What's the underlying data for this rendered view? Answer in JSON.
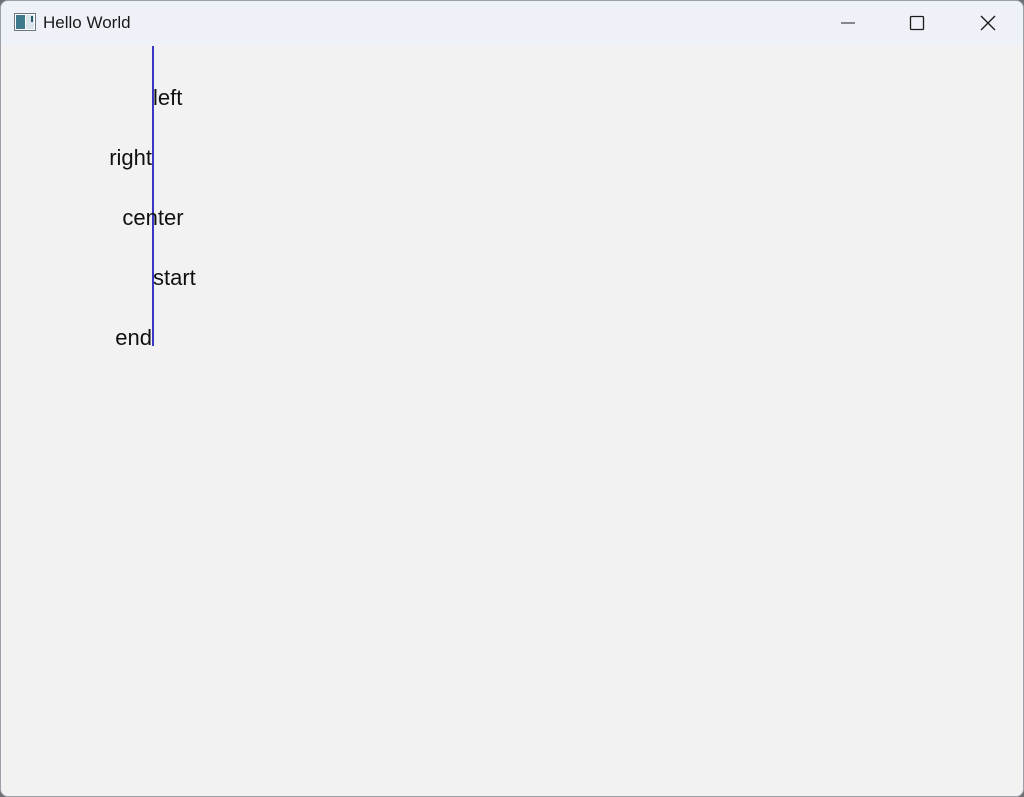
{
  "window": {
    "title": "Hello World",
    "icon": "app-window-icon",
    "controls": {
      "minimize_icon": "minimize-icon",
      "maximize_icon": "maximize-icon",
      "close_icon": "close-icon"
    }
  },
  "canvas": {
    "guide_color": "#3a37c4",
    "labels": {
      "left": "left",
      "right": "right",
      "center": "center",
      "start": "start",
      "end": "end"
    }
  }
}
